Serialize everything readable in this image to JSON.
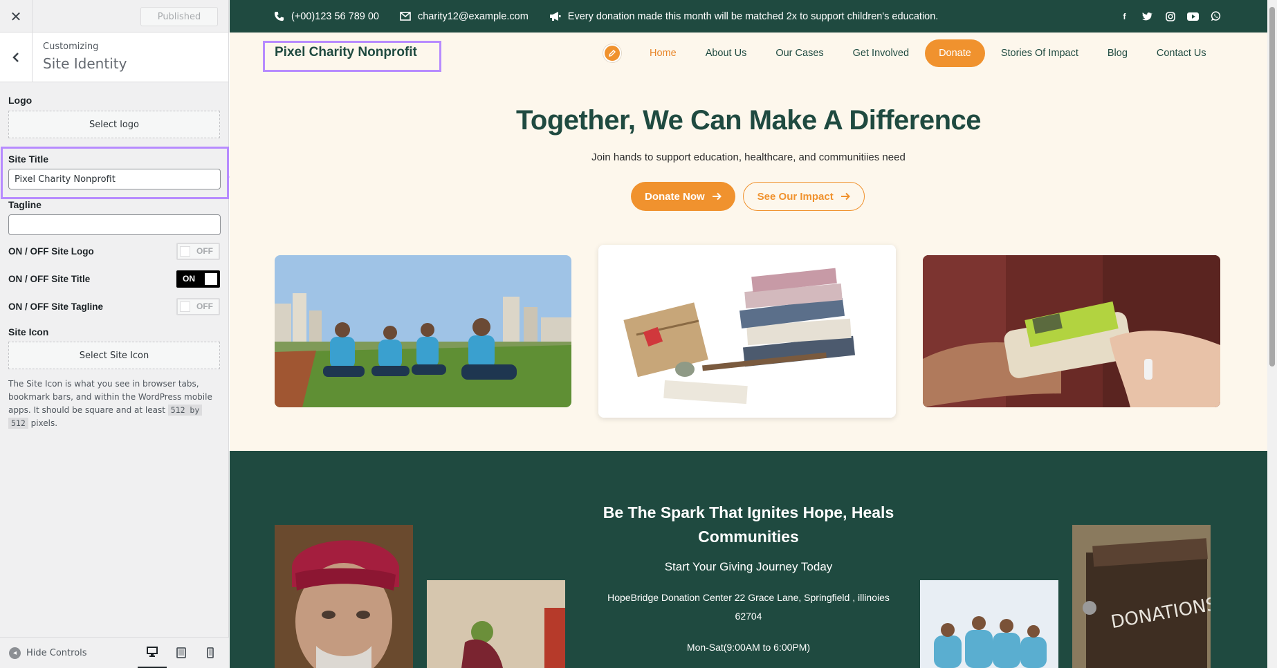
{
  "customizer": {
    "close_icon": "close-icon",
    "publish_label": "Published",
    "back_icon": "chevron-left-icon",
    "breadcrumb": "Customizing",
    "section_title": "Site Identity",
    "logo": {
      "label": "Logo",
      "button": "Select logo"
    },
    "site_title": {
      "label": "Site Title",
      "value": "Pixel Charity Nonprofit"
    },
    "tagline": {
      "label": "Tagline",
      "value": ""
    },
    "toggles": [
      {
        "label": "ON / OFF Site Logo",
        "state": "OFF"
      },
      {
        "label": "ON / OFF Site Title",
        "state": "ON"
      },
      {
        "label": "ON / OFF Site Tagline",
        "state": "OFF"
      }
    ],
    "site_icon": {
      "label": "Site Icon",
      "button": "Select Site Icon",
      "help_1": "The Site Icon is what you see in browser tabs, bookmark bars, and within the WordPress mobile apps. It should be square and at least",
      "help_code_1": "512 by",
      "help_code_2": "512",
      "help_2": "pixels."
    },
    "footer": {
      "hide_controls": "Hide Controls",
      "devices": [
        "desktop-icon",
        "tablet-icon",
        "mobile-icon"
      ],
      "active_device": "desktop-icon"
    },
    "highlight_color": "#b78bff"
  },
  "site": {
    "topbar": {
      "phone": "(+00)123 56 789 00",
      "email": "charity12@example.com",
      "announcement": "Every donation made this month will be matched 2x to support children's education.",
      "socials": [
        "facebook-icon",
        "twitter-icon",
        "instagram-icon",
        "youtube-icon",
        "whatsapp-icon"
      ]
    },
    "brand": "Pixel Charity Nonprofit",
    "nav": [
      "Home",
      "About Us",
      "Our Cases",
      "Get Involved",
      "Donate",
      "Stories Of Impact",
      "Blog",
      "Contact Us"
    ],
    "hero": {
      "title": "Together, We Can Make A Difference",
      "subtitle": "Join hands to support education, healthcare, and communitiies need",
      "btn_primary": "Donate Now",
      "btn_secondary": "See Our Impact"
    },
    "images": [
      "volunteers-photo",
      "books-gifts-photo",
      "handing-donation-photo"
    ],
    "spark": {
      "title_line1": "Be The Spark That Ignites Hope, Heals",
      "title_line2": "Communities",
      "subtitle": "Start Your Giving Journey Today",
      "address_line1": "HopeBridge Donation Center 22 Grace Lane, Springfield , illinoies",
      "address_line2": "62704",
      "hours": "Mon-Sat(9:00AM to 6:00PM)"
    },
    "colors": {
      "primary_green": "#1f4a40",
      "accent_orange": "#f0922e",
      "cream": "#fdf7ec"
    }
  }
}
